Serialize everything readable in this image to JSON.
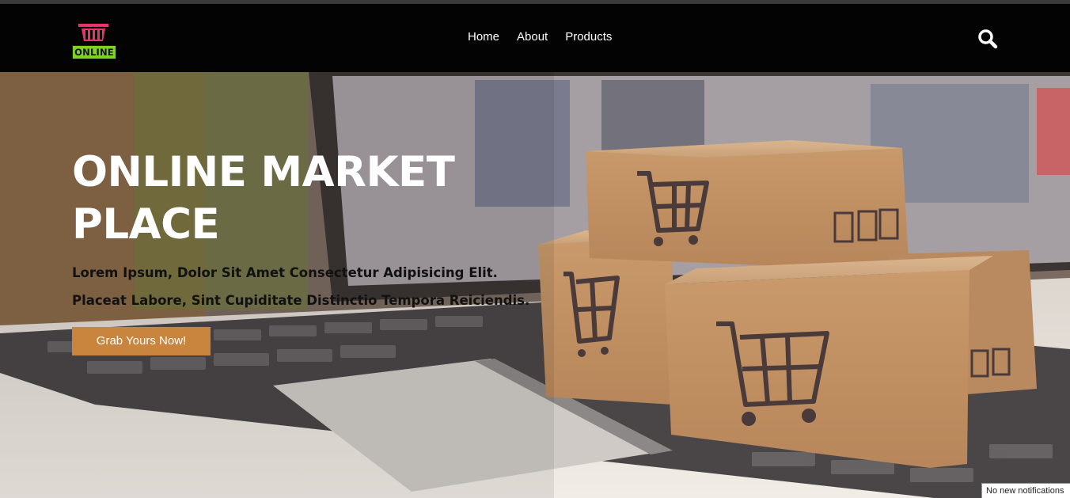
{
  "header": {
    "logo_text": "ONLINE",
    "nav": [
      {
        "label": "Home"
      },
      {
        "label": "About"
      },
      {
        "label": "Products"
      }
    ],
    "search_icon": "search-icon"
  },
  "hero": {
    "title": "ONLINE MARKET PLACE",
    "subtitle": "Lorem Ipsum, Dolor Sit Amet Consectetur Adipisicing Elit. Placeat Labore, Sint Cupiditate Distinctio Tempora Reiciendis.",
    "cta_label": "Grab Yours Now!",
    "background_image": "laptop-with-cardboard-boxes-and-credit-card"
  },
  "notification": {
    "text": "No new notifications"
  },
  "colors": {
    "navbar_bg": "#030303",
    "logo_basket": "#e8336d",
    "logo_label_bg": "#7ed321",
    "cta_bg": "#c9843d",
    "hero_title": "#ffffff"
  }
}
